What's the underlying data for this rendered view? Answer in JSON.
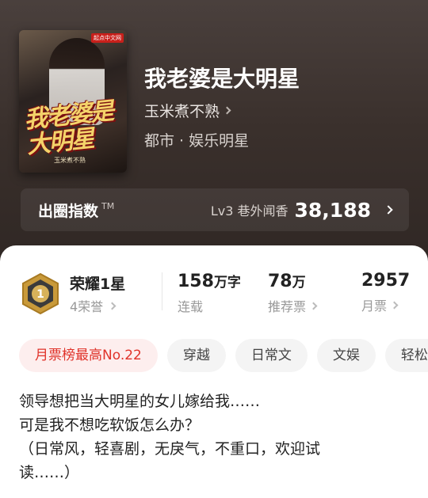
{
  "book": {
    "title": "我老婆是大明星",
    "author": "玉米煮不熟",
    "genre": "都市 · 娱乐明星",
    "cover": {
      "title_text": "我老婆是大明星",
      "author_text": "玉米煮不熟",
      "badge": "起点中文网"
    }
  },
  "fame": {
    "label": "出圈指数",
    "tm": "TM",
    "level": "Lv3 巷外闻香",
    "value": "38,188"
  },
  "honor": {
    "title": "荣耀1星",
    "count": "4荣誉",
    "badge_number": "1"
  },
  "stats": [
    {
      "value": "158",
      "unit": "万字",
      "label": "连载",
      "has_chevron": false
    },
    {
      "value": "78",
      "unit": "万",
      "label": "推荐票",
      "has_chevron": true
    },
    {
      "value": "2957",
      "unit": "",
      "label": "月票",
      "has_chevron": true
    }
  ],
  "tags": [
    {
      "label": "月票榜最高No.22",
      "highlight": true
    },
    {
      "label": "穿越",
      "highlight": false
    },
    {
      "label": "日常文",
      "highlight": false
    },
    {
      "label": "文娱",
      "highlight": false
    },
    {
      "label": "轻松",
      "highlight": false
    }
  ],
  "description": [
    "领导想把当大明星的女儿嫁给我……",
    "可是我不想吃软饭怎么办？",
    "（日常风，轻喜剧，无戾气，不重口，欢迎试",
    "读……）"
  ],
  "colors": {
    "accent_red": "#e0332a",
    "hero_bg": "#3a302c",
    "honor_gold": "#c99a3a"
  },
  "icons": [
    "chevron-right-icon",
    "honor-medal-icon"
  ]
}
